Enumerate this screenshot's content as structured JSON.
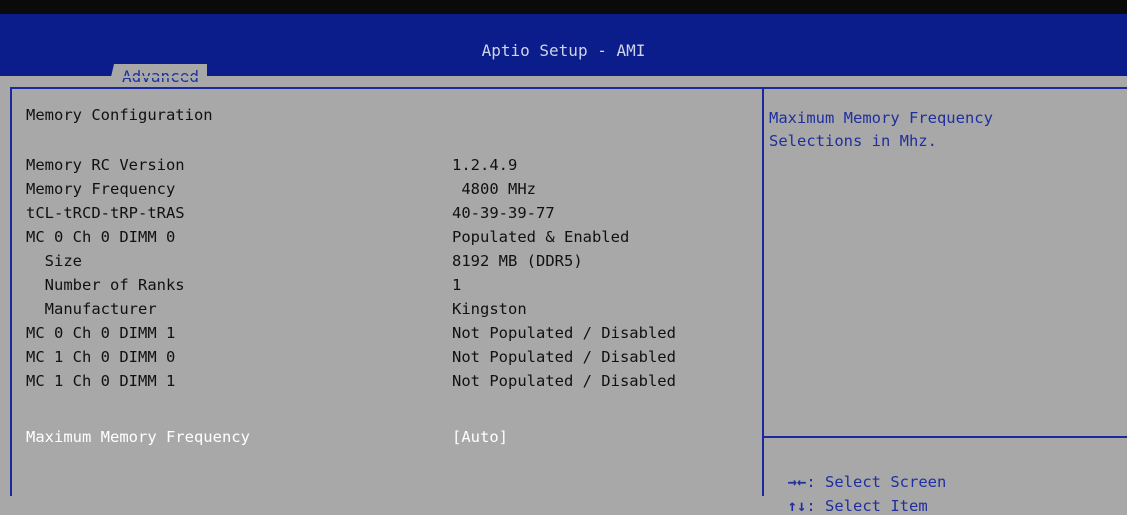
{
  "header": {
    "title": "Aptio Setup - AMI",
    "active_tab": "Advanced"
  },
  "section_title": "Memory Configuration",
  "rows": [
    {
      "label": "Memory RC Version",
      "value": "1.2.4.9"
    },
    {
      "label": "Memory Frequency",
      "value": " 4800 MHz"
    },
    {
      "label": "tCL-tRCD-tRP-tRAS",
      "value": "40-39-39-77"
    },
    {
      "label": "MC 0 Ch 0 DIMM 0",
      "value": "Populated & Enabled"
    },
    {
      "label": "  Size",
      "value": "8192 MB (DDR5)"
    },
    {
      "label": "  Number of Ranks",
      "value": "1"
    },
    {
      "label": "  Manufacturer",
      "value": "Kingston"
    },
    {
      "label": "MC 0 Ch 0 DIMM 1",
      "value": "Not Populated / Disabled"
    },
    {
      "label": "MC 1 Ch 0 DIMM 0",
      "value": "Not Populated / Disabled"
    },
    {
      "label": "MC 1 Ch 0 DIMM 1",
      "value": "Not Populated / Disabled"
    }
  ],
  "selected_option": {
    "label": "Maximum Memory Frequency",
    "value": "[Auto]"
  },
  "help_text": [
    "Maximum Memory Frequency",
    "Selections in Mhz."
  ],
  "key_hints": [
    {
      "key": "→←",
      "action": ": Select Screen"
    },
    {
      "key": "↑↓",
      "action": ": Select Item"
    }
  ],
  "colors": {
    "background": "#a8a8a8",
    "header": "#0a1d8a",
    "accent_blue": "#1f2f9e",
    "selected_text": "#ffffff"
  }
}
